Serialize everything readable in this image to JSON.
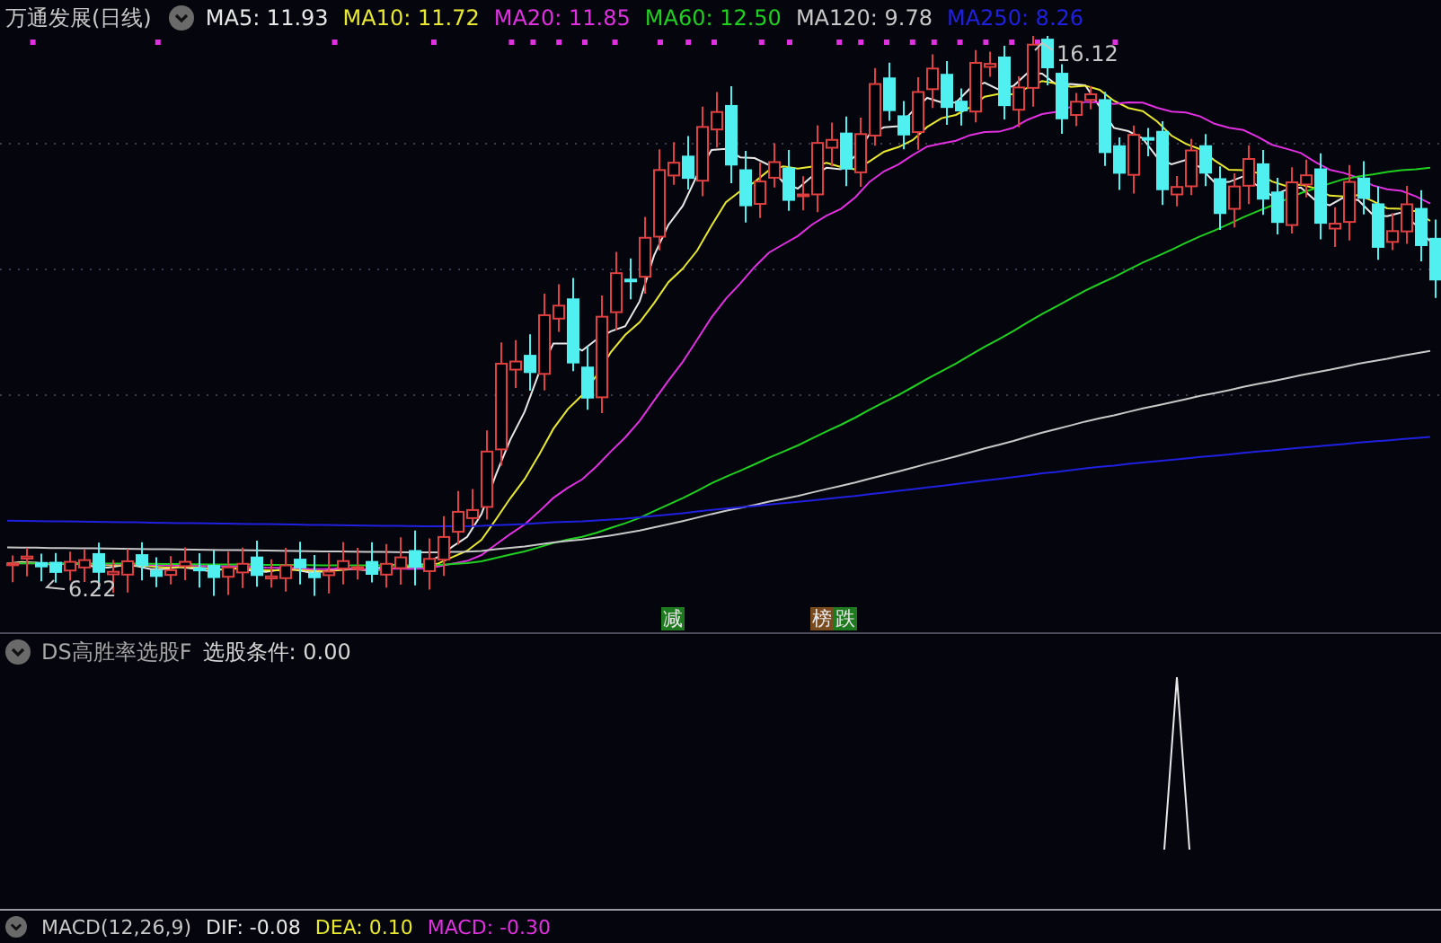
{
  "stock": {
    "name": "万通发展",
    "period": "(日线)"
  },
  "moving_averages": [
    {
      "label": "MA5:",
      "value": "11.93",
      "color": "#e8e8e8"
    },
    {
      "label": "MA10:",
      "value": "11.72",
      "color": "#e8e830"
    },
    {
      "label": "MA20:",
      "value": "11.85",
      "color": "#e030e0"
    },
    {
      "label": "MA60:",
      "value": "12.50",
      "color": "#20d020"
    },
    {
      "label": "MA120:",
      "value": "9.78",
      "color": "#c8c8c8"
    },
    {
      "label": "MA250:",
      "value": "8.26",
      "color": "#2020e0"
    }
  ],
  "price_marks": {
    "high": "16.12",
    "low": "6.22"
  },
  "signal_groups": [
    {
      "items": [
        {
          "text": "减",
          "color": "#1f7a1f"
        }
      ]
    },
    {
      "items": [
        {
          "text": "榜",
          "color": "#7a4a1f"
        },
        {
          "text": "跌",
          "color": "#1f7a1f"
        }
      ]
    }
  ],
  "indicator_panel": {
    "name": "DS高胜率选股F",
    "condition": "选股条件: 0.00"
  },
  "macd_legend": [
    {
      "label": "MACD(12,26,9)",
      "color": "#c8c8c8"
    },
    {
      "label": "DIF: -0.08",
      "color": "#e8e8e8"
    },
    {
      "label": "DEA: 0.10",
      "color": "#e8e830"
    },
    {
      "label": "MACD: -0.30",
      "color": "#e030e0"
    }
  ]
}
